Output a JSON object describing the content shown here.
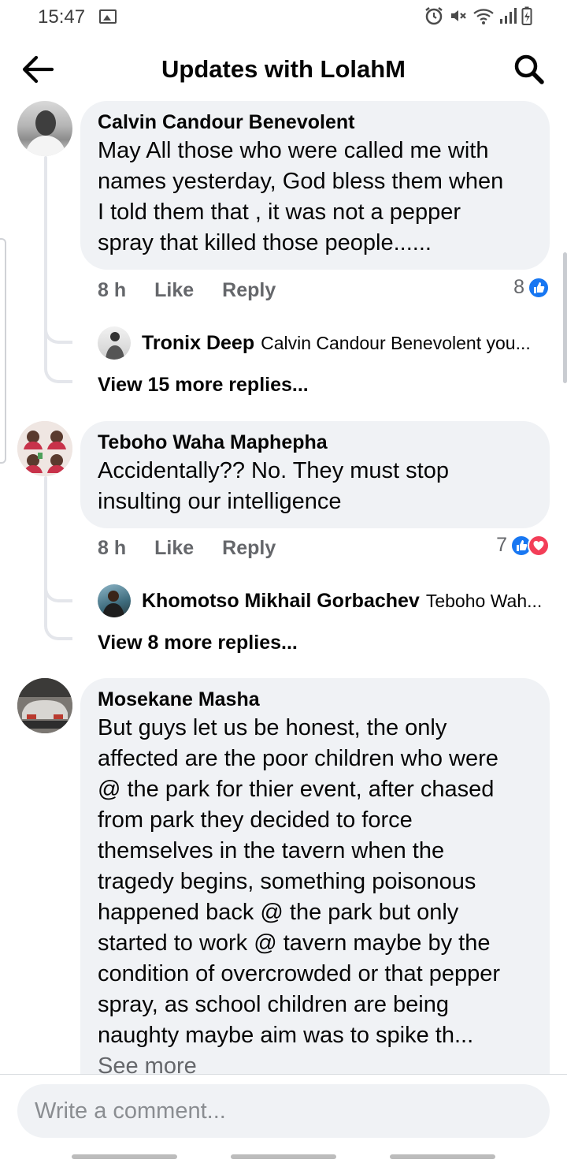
{
  "status_bar": {
    "time": "15:47",
    "icons": [
      "image-icon",
      "alarm-icon",
      "mute-icon",
      "wifi-icon",
      "signal-icon",
      "battery-icon"
    ]
  },
  "header": {
    "title": "Updates with LolahM",
    "back_icon": "arrow-left-icon",
    "search_icon": "search-icon"
  },
  "comments": [
    {
      "author": "Calvin Candour Benevolent",
      "text": "May All those who were called  me with\nnames yesterday, God  bless them when\nI told them that , it was not a pepper\nspray that killed those people......",
      "time": "8 h",
      "like_label": "Like",
      "reply_label": "Reply",
      "reaction_count": "8",
      "reactions": [
        "like"
      ],
      "reply_preview": {
        "author": "Tronix Deep",
        "snippet": "Calvin Candour Benevolent you..."
      },
      "more_replies": "View 15 more replies..."
    },
    {
      "author": "Teboho Waha Maphepha",
      "text": "Accidentally?? No. They must stop\ninsulting our intelligence",
      "time": "8 h",
      "like_label": "Like",
      "reply_label": "Reply",
      "reaction_count": "7",
      "reactions": [
        "like",
        "love"
      ],
      "reply_preview": {
        "author": "Khomotso Mikhail Gorbachev",
        "snippet": "Teboho Wah..."
      },
      "more_replies": "View 8 more replies..."
    },
    {
      "author": "Mosekane Masha",
      "text": "But guys let us be honest, the only\naffected are the poor children who were\n@ the park for thier event, after chased\nfrom park they decided to force\nthemselves in the tavern when the\ntragedy begins, something poisonous\nhappened back @ the park but only\nstarted to work @ tavern maybe by the\ncondition of overcrowded or that pepper\nspray, as school children are being\nnaughty maybe aim was to spike th...",
      "see_more": "See more"
    }
  ],
  "composer": {
    "placeholder": "Write a comment..."
  },
  "colors": {
    "bubble": "#f0f2f5",
    "like_blue": "#1877f2",
    "love_red": "#f33e58",
    "meta_gray": "#65676b"
  }
}
